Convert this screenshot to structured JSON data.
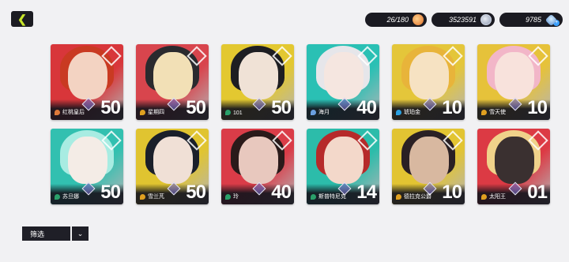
{
  "header": {
    "back_icon": "chevron-left-icon",
    "resources": {
      "energy": {
        "value": "26/180",
        "icon": "energy-orb-icon"
      },
      "coins": {
        "value": "3523591",
        "icon": "coin-icon"
      },
      "gems": {
        "value": "9785",
        "icon": "gem-icon"
      }
    }
  },
  "characters": [
    {
      "name": "红桃皇后",
      "level": "50",
      "bg": "#d8363a",
      "hair": "#c93a22",
      "face": "#f3d3c2",
      "elem": "#e07a3a"
    },
    {
      "name": "星期四",
      "level": "50",
      "bg": "#d8454d",
      "hair": "#2a2a2e",
      "face": "#f2e0b6",
      "elem": "#e0a020"
    },
    {
      "name": "101",
      "level": "50",
      "bg": "#e3c830",
      "hair": "#1e1e22",
      "face": "#f0e2d6",
      "elem": "#2aa06a"
    },
    {
      "name": "海月",
      "level": "40",
      "bg": "#2ac0b4",
      "hair": "#e6e6ea",
      "face": "#f5e6e0",
      "elem": "#6aa0e0"
    },
    {
      "name": "琥珀金",
      "level": "10",
      "bg": "#e4c63a",
      "hair": "#e8b43a",
      "face": "#f6e2c2",
      "elem": "#2aa0e0"
    },
    {
      "name": "雪天使",
      "level": "10",
      "bg": "#e6c23a",
      "hair": "#f2b6c8",
      "face": "#f8e2dc",
      "elem": "#e0a020"
    },
    {
      "name": "苏旦娜",
      "level": "50",
      "bg": "#32c0b0",
      "hair": "#a8ece2",
      "face": "#f4ece6",
      "elem": "#2aa06a"
    },
    {
      "name": "雪兰芃",
      "level": "50",
      "bg": "#e0c430",
      "hair": "#1a1f2a",
      "face": "#f0e0d6",
      "elem": "#e0a020"
    },
    {
      "name": "玲",
      "level": "40",
      "bg": "#da3c48",
      "hair": "#2a1a1a",
      "face": "#e8c8be",
      "elem": "#2aa06a"
    },
    {
      "name": "斯普特尼克",
      "level": "14",
      "bg": "#2cbcaa",
      "hair": "#b62a2a",
      "face": "#f3d8ca",
      "elem": "#2aa06a"
    },
    {
      "name": "德拉克公爵",
      "level": "10",
      "bg": "#e2c432",
      "hair": "#2a2024",
      "face": "#d8b8a0",
      "elem": "#e0a020"
    },
    {
      "name": "太阳王",
      "level": "01",
      "bg": "#dc3a44",
      "hair": "#f0d28a",
      "face": "#3a3030",
      "elem": "#e0a020"
    }
  ],
  "footer": {
    "filter_label": "筛选",
    "filter_toggle_icon": "chevron-down-icon"
  }
}
